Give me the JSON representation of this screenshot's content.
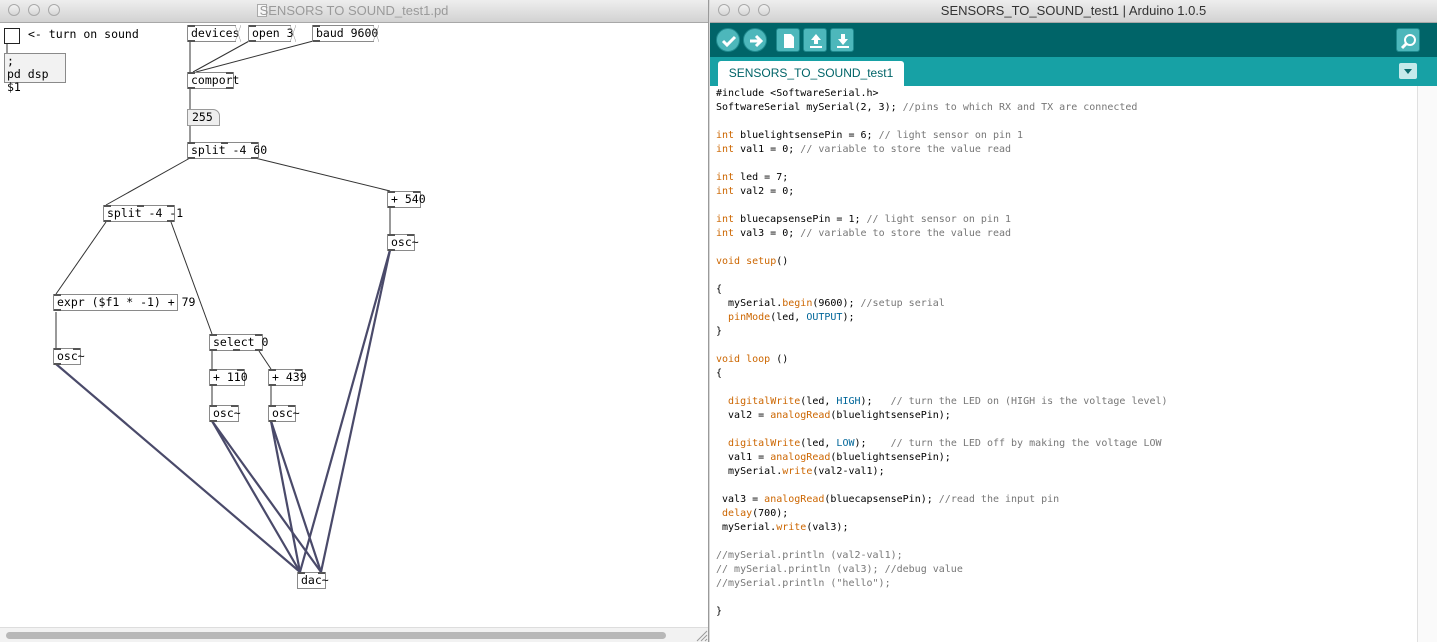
{
  "pd": {
    "title": "SENSORS TO SOUND_test1.pd",
    "toggle_comment": "<- turn on sound",
    "dsp_message_line1": ";",
    "dsp_message_line2": "pd dsp $1",
    "devices_msg": "devices",
    "open_msg": "open 3",
    "baud_msg": "baud 9600",
    "comport_obj": "comport",
    "number_value": "255",
    "split_main": "split -4 60",
    "split_left": "split -4 -1",
    "plus_540": "+ 540",
    "osc_right": "osc~",
    "expr_obj": "expr ($f1 * -1) + 79",
    "osc_left": "osc~",
    "select_obj": "select 0",
    "plus_110": "+ 110",
    "plus_439": "+ 439",
    "osc_mid1": "osc~",
    "osc_mid2": "osc~",
    "dac_obj": "dac~"
  },
  "arduino": {
    "title": "SENSORS_TO_SOUND_test1 | Arduino 1.0.5",
    "tab_label": "SENSORS_TO_SOUND_test1",
    "toolbar_icons": [
      "verify-icon",
      "upload-icon",
      "new-icon",
      "open-icon",
      "save-icon",
      "serial-monitor-icon"
    ],
    "code_lines": [
      "#include <SoftwareSerial.h>",
      "SoftwareSerial mySerial(2, 3); //pins to which RX and TX are connected",
      "",
      "int bluelightsensePin = 6; // light sensor on pin 1",
      "int val1 = 0; // variable to store the value read",
      "",
      "int led = 7;",
      "int val2 = 0;",
      "",
      "int bluecapsensePin = 1; // light sensor on pin 1",
      "int val3 = 0; // variable to store the value read",
      "",
      "void setup()",
      "",
      "{",
      "  mySerial.begin(9600); //setup serial",
      "  pinMode(led, OUTPUT);",
      "}",
      "",
      "void loop ()",
      "{",
      "",
      "  digitalWrite(led, HIGH);   // turn the LED on (HIGH is the voltage level)",
      "  val2 = analogRead(bluelightsensePin);",
      "",
      "  digitalWrite(led, LOW);    // turn the LED off by making the voltage LOW",
      "  val1 = analogRead(bluelightsensePin);",
      "  mySerial.write(val2-val1);",
      "",
      " val3 = analogRead(bluecapsensePin); //read the input pin",
      " delay(700);",
      " mySerial.write(val3);",
      "",
      "//mySerial.println (val2-val1);",
      "// mySerial.println (val3); //debug value",
      "//mySerial.println (\"hello\");",
      "",
      "}"
    ]
  },
  "colors": {
    "arduino_toolbar": "#006468",
    "arduino_tabbar": "#17a1a5",
    "arduino_button": "#4db7bb",
    "arduino_keyword": "#cc6600",
    "arduino_comment": "#777777",
    "arduino_constant": "#006699",
    "pd_signal_wire": "#4a4a6a"
  }
}
